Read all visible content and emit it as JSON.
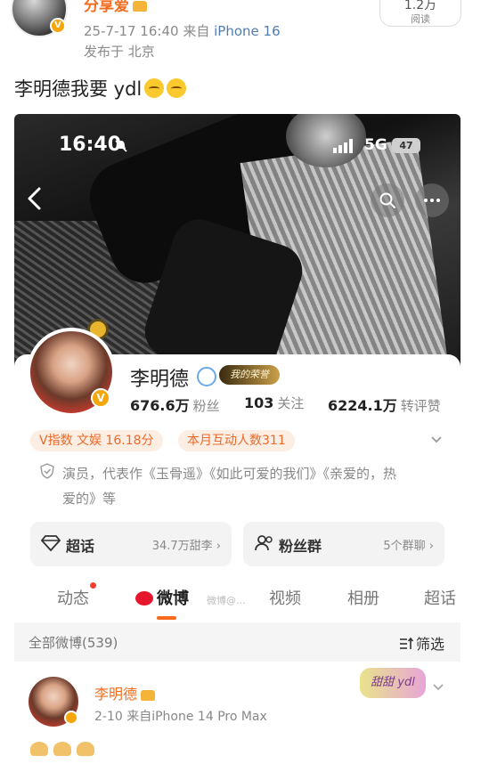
{
  "post": {
    "author": "分享爱",
    "date": "25-7-17 16:40",
    "from_prefix": "来自",
    "device": "iPhone 16",
    "location": "发布于 北京",
    "read_count": "1.2万",
    "read_label": "阅读",
    "text": "李明德我要 ydl"
  },
  "screenshot": {
    "status_bar": {
      "time": "16:40",
      "network": "5G",
      "battery": "47"
    },
    "profile": {
      "name": "李明德",
      "vip_badge": "我的荣誉",
      "followers": {
        "value": "676.6万",
        "label": "粉丝"
      },
      "following": {
        "value": "103",
        "label": "关注"
      },
      "reposts": {
        "value": "6224.1万",
        "label": "转评赞"
      },
      "tags": [
        "V指数 文娱 16.18分",
        "本月互动人数311"
      ],
      "bio": "演员，代表作《玉骨遥》《如此可爱的我们》《亲爱的，热爱的》等",
      "cards": [
        {
          "title": "超话",
          "sub": "34.7万甜李 ›"
        },
        {
          "title": "粉丝群",
          "sub": "5个群聊 ›"
        }
      ],
      "tabs": [
        "动态",
        "微博",
        "视频",
        "相册",
        "超话"
      ],
      "watermark": "微博@...",
      "filter_label": "全部微博(539)",
      "filter_button": "筛选"
    },
    "feed": {
      "name": "李明德",
      "meta": "2-10 来自iPhone 14 Pro Max",
      "sticker": "甜甜 ydl"
    }
  },
  "colors": {
    "accent_orange": "#f26d1f",
    "link_blue": "#507daf",
    "tag_bg": "#fdeee3",
    "weibo_red": "#e6162d"
  }
}
